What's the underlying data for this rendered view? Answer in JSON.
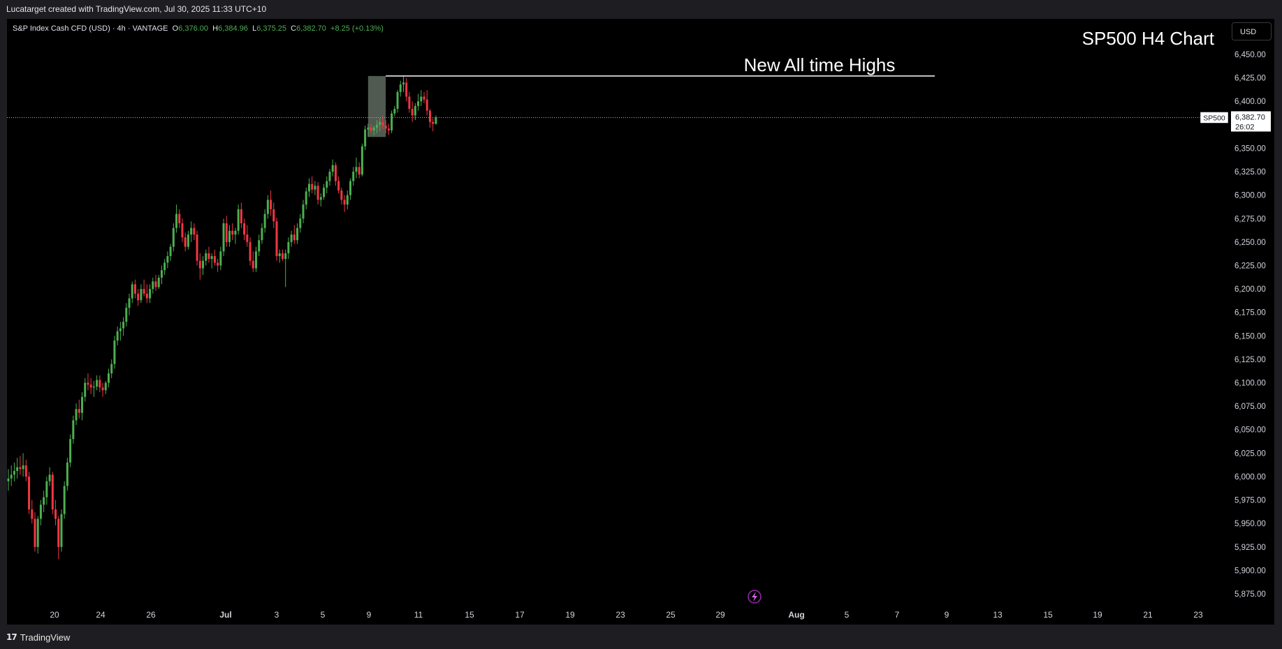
{
  "header": {
    "credit": "Lucatarget created with TradingView.com, Jul 30, 2025 11:33 UTC+10"
  },
  "legend": {
    "symbol": "S&P Index Cash CFD (USD) · 4h · VANTAGE",
    "o_label": "O",
    "o_value": "6,376.00",
    "h_label": "H",
    "h_value": "6,384.96",
    "l_label": "L",
    "l_value": "6,375.25",
    "c_label": "C",
    "c_value": "6,382.70",
    "change": "+8.25 (+0.13%)"
  },
  "currency_button": "USD",
  "footer": {
    "brand": "TradingView",
    "logo_glyph": "17"
  },
  "chart_data": {
    "type": "candlestick",
    "title": "SP500 H4 Chart",
    "annotation": "New All time Highs",
    "y_ticks": [
      6450,
      6425,
      6400,
      6375,
      6350,
      6325,
      6300,
      6275,
      6250,
      6225,
      6200,
      6175,
      6150,
      6125,
      6100,
      6075,
      6050,
      6025,
      6000,
      5975,
      5950,
      5925,
      5900,
      5875
    ],
    "y_tick_labels": [
      "6,450.00",
      "6,425.00",
      "6,400.00",
      "",
      "6,350.00",
      "6,325.00",
      "6,300.00",
      "6,275.00",
      "6,250.00",
      "6,225.00",
      "6,200.00",
      "6,175.00",
      "6,150.00",
      "6,125.00",
      "6,100.00",
      "6,075.00",
      "6,050.00",
      "6,025.00",
      "6,000.00",
      "5,975.00",
      "5,950.00",
      "5,925.00",
      "5,900.00",
      "5,875.00"
    ],
    "x_labels": [
      "20",
      "24",
      "26",
      "Jul",
      "3",
      "5",
      "9",
      "11",
      "15",
      "17",
      "19",
      "23",
      "25",
      "29",
      "Aug",
      "5",
      "7",
      "9",
      "13",
      "15",
      "19",
      "21",
      "23"
    ],
    "x_label_positions": [
      78,
      144,
      216,
      323,
      396,
      462,
      528,
      599,
      672,
      744,
      816,
      888,
      960,
      1031,
      1140,
      1212,
      1284,
      1355,
      1428,
      1500,
      1571,
      1643,
      1715
    ],
    "y_range": [
      5867,
      6460
    ],
    "price_line": {
      "series": "SP500",
      "value": 6382.7,
      "price_text": "6,382.70",
      "countdown": "26:02"
    },
    "highlight_box": {
      "x_start": 122,
      "x_end": 128,
      "y_low": 6362,
      "y_high": 6427
    },
    "ath_line": {
      "x_start": 128,
      "x_end": 170,
      "value": 6427
    },
    "up_color": "#4caf50",
    "down_color": "#f23645",
    "ohlc": [
      [
        5995,
        6008,
        5985,
        5998
      ],
      [
        5998,
        6012,
        5990,
        6002
      ],
      [
        6002,
        6015,
        5995,
        6006
      ],
      [
        6006,
        6020,
        5998,
        6010
      ],
      [
        6010,
        6022,
        6002,
        6008
      ],
      [
        6008,
        6025,
        6000,
        6012
      ],
      [
        6012,
        6018,
        5995,
        6000
      ],
      [
        6000,
        6005,
        5960,
        5965
      ],
      [
        5965,
        5975,
        5950,
        5955
      ],
      [
        5955,
        5962,
        5920,
        5925
      ],
      [
        5925,
        5958,
        5918,
        5955
      ],
      [
        5955,
        5975,
        5948,
        5970
      ],
      [
        5970,
        5985,
        5962,
        5978
      ],
      [
        5978,
        6000,
        5970,
        5995
      ],
      [
        5995,
        6010,
        5990,
        6002
      ],
      [
        6002,
        6005,
        5960,
        5965
      ],
      [
        5965,
        5975,
        5948,
        5955
      ],
      [
        5955,
        5958,
        5912,
        5925
      ],
      [
        5925,
        5965,
        5920,
        5960
      ],
      [
        5960,
        5995,
        5955,
        5990
      ],
      [
        5990,
        6020,
        5985,
        6015
      ],
      [
        6015,
        6045,
        6010,
        6040
      ],
      [
        6040,
        6065,
        6035,
        6060
      ],
      [
        6060,
        6078,
        6055,
        6072
      ],
      [
        6072,
        6082,
        6062,
        6068
      ],
      [
        6068,
        6090,
        6060,
        6085
      ],
      [
        6085,
        6105,
        6080,
        6100
      ],
      [
        6100,
        6110,
        6092,
        6098
      ],
      [
        6098,
        6105,
        6088,
        6095
      ],
      [
        6095,
        6102,
        6085,
        6096
      ],
      [
        6096,
        6108,
        6092,
        6103
      ],
      [
        6103,
        6108,
        6090,
        6095
      ],
      [
        6095,
        6100,
        6085,
        6092
      ],
      [
        6092,
        6102,
        6088,
        6100
      ],
      [
        6100,
        6115,
        6095,
        6110
      ],
      [
        6110,
        6125,
        6105,
        6120
      ],
      [
        6120,
        6150,
        6115,
        6145
      ],
      [
        6145,
        6160,
        6140,
        6155
      ],
      [
        6155,
        6165,
        6145,
        6158
      ],
      [
        6158,
        6170,
        6150,
        6165
      ],
      [
        6165,
        6185,
        6160,
        6180
      ],
      [
        6180,
        6195,
        6172,
        6190
      ],
      [
        6190,
        6208,
        6185,
        6205
      ],
      [
        6205,
        6210,
        6190,
        6195
      ],
      [
        6195,
        6200,
        6182,
        6188
      ],
      [
        6188,
        6205,
        6185,
        6200
      ],
      [
        6200,
        6210,
        6192,
        6195
      ],
      [
        6195,
        6205,
        6185,
        6190
      ],
      [
        6190,
        6205,
        6185,
        6200
      ],
      [
        6200,
        6212,
        6195,
        6208
      ],
      [
        6208,
        6215,
        6198,
        6202
      ],
      [
        6202,
        6215,
        6200,
        6212
      ],
      [
        6212,
        6225,
        6205,
        6220
      ],
      [
        6220,
        6232,
        6215,
        6228
      ],
      [
        6228,
        6240,
        6222,
        6235
      ],
      [
        6235,
        6248,
        6230,
        6245
      ],
      [
        6245,
        6270,
        6240,
        6265
      ],
      [
        6265,
        6290,
        6260,
        6280
      ],
      [
        6280,
        6285,
        6265,
        6270
      ],
      [
        6270,
        6275,
        6250,
        6255
      ],
      [
        6255,
        6260,
        6240,
        6245
      ],
      [
        6245,
        6262,
        6242,
        6258
      ],
      [
        6258,
        6272,
        6250,
        6265
      ],
      [
        6265,
        6270,
        6252,
        6258
      ],
      [
        6258,
        6262,
        6225,
        6230
      ],
      [
        6230,
        6238,
        6210,
        6222
      ],
      [
        6222,
        6235,
        6215,
        6230
      ],
      [
        6230,
        6242,
        6225,
        6238
      ],
      [
        6238,
        6245,
        6228,
        6232
      ],
      [
        6232,
        6238,
        6222,
        6235
      ],
      [
        6235,
        6242,
        6225,
        6228
      ],
      [
        6228,
        6232,
        6218,
        6225
      ],
      [
        6225,
        6245,
        6220,
        6240
      ],
      [
        6240,
        6275,
        6235,
        6270
      ],
      [
        6270,
        6278,
        6245,
        6250
      ],
      [
        6250,
        6268,
        6245,
        6262
      ],
      [
        6262,
        6270,
        6252,
        6258
      ],
      [
        6258,
        6265,
        6248,
        6262
      ],
      [
        6262,
        6290,
        6258,
        6285
      ],
      [
        6285,
        6292,
        6265,
        6270
      ],
      [
        6270,
        6275,
        6252,
        6258
      ],
      [
        6258,
        6268,
        6245,
        6250
      ],
      [
        6250,
        6255,
        6225,
        6230
      ],
      [
        6230,
        6240,
        6218,
        6222
      ],
      [
        6222,
        6245,
        6218,
        6240
      ],
      [
        6240,
        6258,
        6235,
        6252
      ],
      [
        6252,
        6270,
        6248,
        6265
      ],
      [
        6265,
        6285,
        6260,
        6280
      ],
      [
        6280,
        6300,
        6275,
        6295
      ],
      [
        6295,
        6305,
        6278,
        6285
      ],
      [
        6285,
        6292,
        6265,
        6272
      ],
      [
        6272,
        6276,
        6230,
        6235
      ],
      [
        6235,
        6242,
        6228,
        6238
      ],
      [
        6238,
        6242,
        6230,
        6232
      ],
      [
        6232,
        6242,
        6202,
        6238
      ],
      [
        6238,
        6255,
        6232,
        6250
      ],
      [
        6250,
        6262,
        6245,
        6258
      ],
      [
        6258,
        6268,
        6248,
        6252
      ],
      [
        6252,
        6270,
        6248,
        6265
      ],
      [
        6265,
        6280,
        6260,
        6275
      ],
      [
        6275,
        6295,
        6270,
        6290
      ],
      [
        6290,
        6308,
        6285,
        6304
      ],
      [
        6304,
        6318,
        6298,
        6312
      ],
      [
        6312,
        6320,
        6302,
        6306
      ],
      [
        6306,
        6315,
        6300,
        6310
      ],
      [
        6310,
        6314,
        6290,
        6295
      ],
      [
        6295,
        6302,
        6288,
        6298
      ],
      [
        6298,
        6312,
        6295,
        6308
      ],
      [
        6308,
        6320,
        6302,
        6315
      ],
      [
        6315,
        6328,
        6310,
        6325
      ],
      [
        6325,
        6338,
        6320,
        6332
      ],
      [
        6332,
        6335,
        6310,
        6315
      ],
      [
        6315,
        6320,
        6302,
        6305
      ],
      [
        6305,
        6308,
        6290,
        6295
      ],
      [
        6295,
        6300,
        6282,
        6290
      ],
      [
        6290,
        6305,
        6285,
        6300
      ],
      [
        6300,
        6318,
        6295,
        6315
      ],
      [
        6315,
        6330,
        6310,
        6325
      ],
      [
        6325,
        6340,
        6318,
        6330
      ],
      [
        6330,
        6335,
        6318,
        6322
      ],
      [
        6322,
        6355,
        6320,
        6352
      ],
      [
        6352,
        6374,
        6348,
        6370
      ],
      [
        6370,
        6376,
        6362,
        6372
      ],
      [
        6372,
        6376,
        6366,
        6369
      ],
      [
        6369,
        6374,
        6364,
        6372
      ],
      [
        6372,
        6380,
        6366,
        6375
      ],
      [
        6375,
        6382,
        6368,
        6378
      ],
      [
        6378,
        6385,
        6370,
        6374
      ],
      [
        6374,
        6380,
        6366,
        6371
      ],
      [
        6371,
        6376,
        6364,
        6369
      ],
      [
        6369,
        6390,
        6366,
        6387
      ],
      [
        6387,
        6395,
        6384,
        6392
      ],
      [
        6392,
        6412,
        6388,
        6410
      ],
      [
        6410,
        6422,
        6405,
        6418
      ],
      [
        6418,
        6427,
        6410,
        6420
      ],
      [
        6420,
        6425,
        6400,
        6405
      ],
      [
        6405,
        6410,
        6388,
        6392
      ],
      [
        6392,
        6400,
        6378,
        6385
      ],
      [
        6385,
        6398,
        6380,
        6395
      ],
      [
        6395,
        6408,
        6390,
        6400
      ],
      [
        6400,
        6412,
        6395,
        6405
      ],
      [
        6405,
        6410,
        6398,
        6402
      ],
      [
        6402,
        6412,
        6385,
        6390
      ],
      [
        6390,
        6392,
        6372,
        6378
      ],
      [
        6378,
        6382,
        6368,
        6376
      ],
      [
        6376,
        6384.96,
        6375.25,
        6382.7
      ]
    ]
  }
}
